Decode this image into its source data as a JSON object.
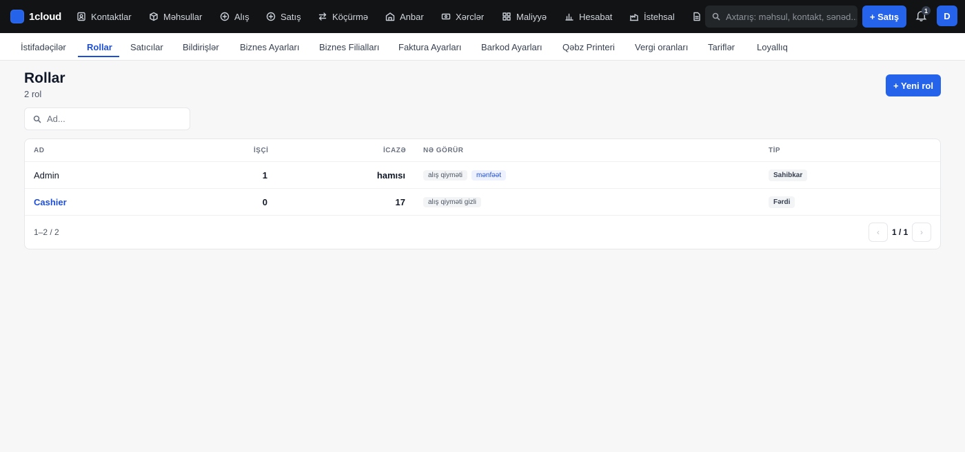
{
  "brand": {
    "name": "1cloud"
  },
  "topnav": [
    {
      "label": "Kontaktlar",
      "icon": "contacts-icon"
    },
    {
      "label": "Məhsullar",
      "icon": "box-icon"
    },
    {
      "label": "Alış",
      "icon": "plus-circle-icon"
    },
    {
      "label": "Satış",
      "icon": "plus-circle-icon"
    },
    {
      "label": "Köçürmə",
      "icon": "transfer-icon"
    },
    {
      "label": "Anbar",
      "icon": "warehouse-icon"
    },
    {
      "label": "Xərclər",
      "icon": "cash-icon"
    },
    {
      "label": "Maliyyə",
      "icon": "grid-icon"
    },
    {
      "label": "Hesabat",
      "icon": "bar-chart-icon"
    },
    {
      "label": "İstehsal",
      "icon": "factory-icon"
    }
  ],
  "search": {
    "placeholder": "Axtarış: məhsul, kontakt, sənəd..."
  },
  "header_actions": {
    "sale_label": "+ Satış",
    "notification_count": "1",
    "avatar_letter": "D"
  },
  "subnav": {
    "active_index": 1,
    "tabs": [
      "İstifadəçilər",
      "Rollar",
      "Satıcılar",
      "Bildirişlər",
      "Biznes Ayarları",
      "Biznes Filialları",
      "Faktura Ayarları",
      "Barkod Ayarları",
      "Qəbz Printeri",
      "Vergi oranları",
      "Tariflər",
      "Loyallıq"
    ]
  },
  "page": {
    "title": "Rollar",
    "subtitle": "2 rol",
    "new_button": "+ Yeni rol",
    "filter_placeholder": "Ad..."
  },
  "table": {
    "headers": {
      "name": "AD",
      "workers": "İŞÇİ",
      "permissions": "İCAZƏ",
      "sees": "NƏ GÖRÜR",
      "type": "TİP"
    },
    "rows": [
      {
        "name": "Admin",
        "workers": "1",
        "permissions": "hamısı",
        "sees": [
          "alış qiyməti",
          "mənfəət"
        ],
        "type": "Sahibkar",
        "link": false
      },
      {
        "name": "Cashier",
        "workers": "0",
        "permissions": "17",
        "sees": [
          "alış qiyməti gizli"
        ],
        "type": "Fərdi",
        "link": true
      }
    ]
  },
  "pagination": {
    "range": "1–2 / 2",
    "page": "1 / 1"
  }
}
